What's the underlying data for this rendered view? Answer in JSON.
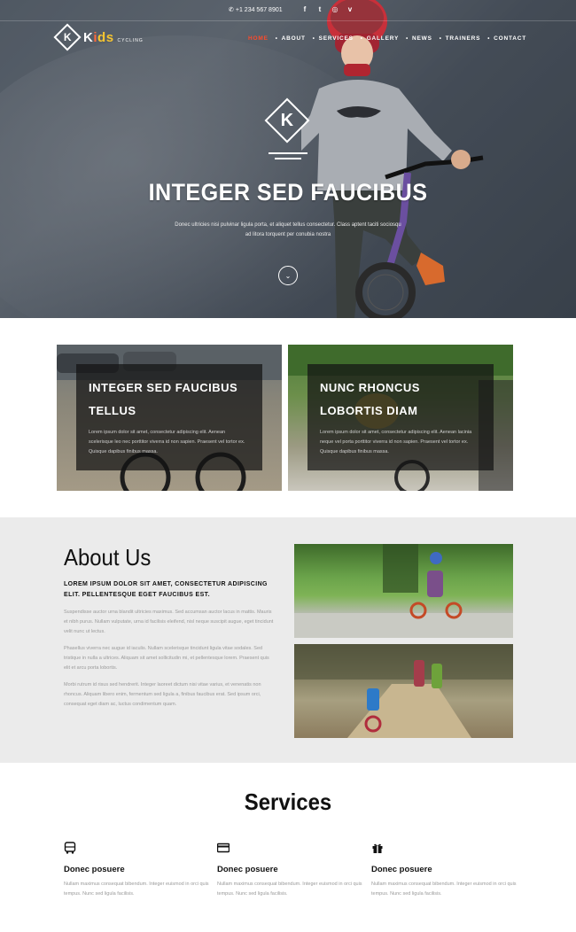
{
  "topbar": {
    "phone": "+1 234 567 8901",
    "social_icons": [
      "facebook-icon",
      "twitter-icon",
      "instagram-icon",
      "vimeo-icon"
    ],
    "social_glyphs": [
      "f",
      "t",
      "◎",
      "v"
    ]
  },
  "logo": {
    "mark": "K",
    "word_k": "K",
    "word_i": "i",
    "word_d": "d",
    "word_s": "s",
    "sub": "CYCLING"
  },
  "nav": {
    "items": [
      {
        "label": "HOME",
        "active": true
      },
      {
        "label": "ABOUT",
        "active": false
      },
      {
        "label": "SERVICES",
        "active": false
      },
      {
        "label": "GALLERY",
        "active": false
      },
      {
        "label": "NEWS",
        "active": false
      },
      {
        "label": "TRAINERS",
        "active": false
      },
      {
        "label": "CONTACT",
        "active": false
      }
    ]
  },
  "hero": {
    "mark": "K",
    "title": "INTEGER SED FAUCIBUS",
    "subtitle": "Donec ultricies nisi pulvinar ligula porta, et aliquet tellus consectetur. Class aptent taciti sociosqu ad litora torquent per conubia nostra"
  },
  "features": [
    {
      "title": "INTEGER SED FAUCIBUS TELLUS",
      "text": "Lorem ipsum dolor sit amet, consectetur adipiscing elit. Aenean scelerisque leo nec porttitor viverra id non sapien. Praesent vel tortor ex. Quisque dapibus finibus massa."
    },
    {
      "title": "NUNC RHONCUS LOBORTIS DIAM",
      "text": "Lorem ipsum dolor sit amet, consectetur adipiscing elit. Aenean lacinia neque vel porta porttitor viverra id non sapien. Praesent vel tortor ex. Quisque dapibus finibus massa."
    }
  ],
  "about": {
    "title": "About Us",
    "lead": "LOREM IPSUM DOLOR SIT AMET, CONSECTETUR ADIPISCING ELIT. PELLENTESQUE EGET FAUCIBUS EST.",
    "paragraphs": [
      "Suspendisse auctor urna blandit ultricies maximus. Sed accumsan auctor lacus in mattis. Mauris et nibh purus. Nullam vulputate, urna id facilisis eleifend, nisl neque suscipit augue, eget tincidunt velit nunc ut lectus.",
      "Phasellus viverra nec augue id iaculis. Nullam scelerisque tincidunt ligula vitae sodales. Sed tristique in nulla a ultrices. Aliquam sit amet sollicitudin mi, et pellentesque lorem. Praesent quis elit et arcu porta lobortis.",
      "Morbi rutrum id risus sed hendrerit. Integer laoreet dictum nisi vitae varius, et venenatis non rhoncus. Aliquam libero enim, fermentum sed ligula a, finibus faucibus erat. Sed ipsum orci, consequat eget diam ac, luctus condimentum quam."
    ]
  },
  "services": {
    "title": "Services",
    "items": [
      {
        "icon": "bus-icon",
        "title": "Donec posuere",
        "text": "Nullam maximus consequat bibendum. Integer euismod in orci quis tempus. Nunc sed ligula facilisis."
      },
      {
        "icon": "credit-card-icon",
        "title": "Donec posuere",
        "text": "Nullam maximus consequat bibendum. Integer euismod in orci quis tempus. Nunc sed ligula facilisis."
      },
      {
        "icon": "gift-icon",
        "title": "Donec posuere",
        "text": "Nullam maximus consequat bibendum. Integer euismod in orci quis tempus. Nunc sed ligula facilisis."
      }
    ]
  }
}
